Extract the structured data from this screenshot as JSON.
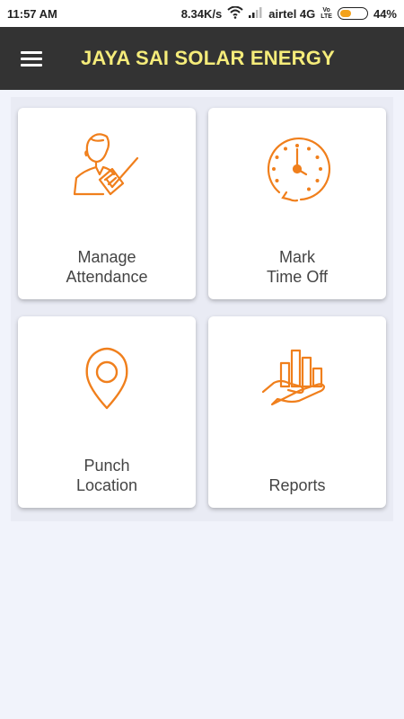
{
  "status_bar": {
    "time": "11:57 AM",
    "speed": "8.34K/s",
    "carrier": "airtel 4G",
    "volte_top": "Vo",
    "volte_bottom": "LTE",
    "battery_percent": "44%",
    "battery_level": 0.44
  },
  "app_bar": {
    "menu_icon": "hamburger-icon",
    "title": "JAYA SAI SOLAR ENERGY"
  },
  "tiles": [
    {
      "line1": "Manage",
      "line2": "Attendance",
      "icon": "attendance-icon"
    },
    {
      "line1": "Mark",
      "line2": "Time Off",
      "icon": "clock-icon"
    },
    {
      "line1": "Punch",
      "line2": "Location",
      "icon": "location-pin-icon"
    },
    {
      "line1": "Reports",
      "line2": "",
      "icon": "reports-chart-icon"
    }
  ],
  "colors": {
    "accent": "#f07f1c",
    "appbar": "#333333",
    "title": "#f5ec7a",
    "background": "#f1f3fb"
  }
}
